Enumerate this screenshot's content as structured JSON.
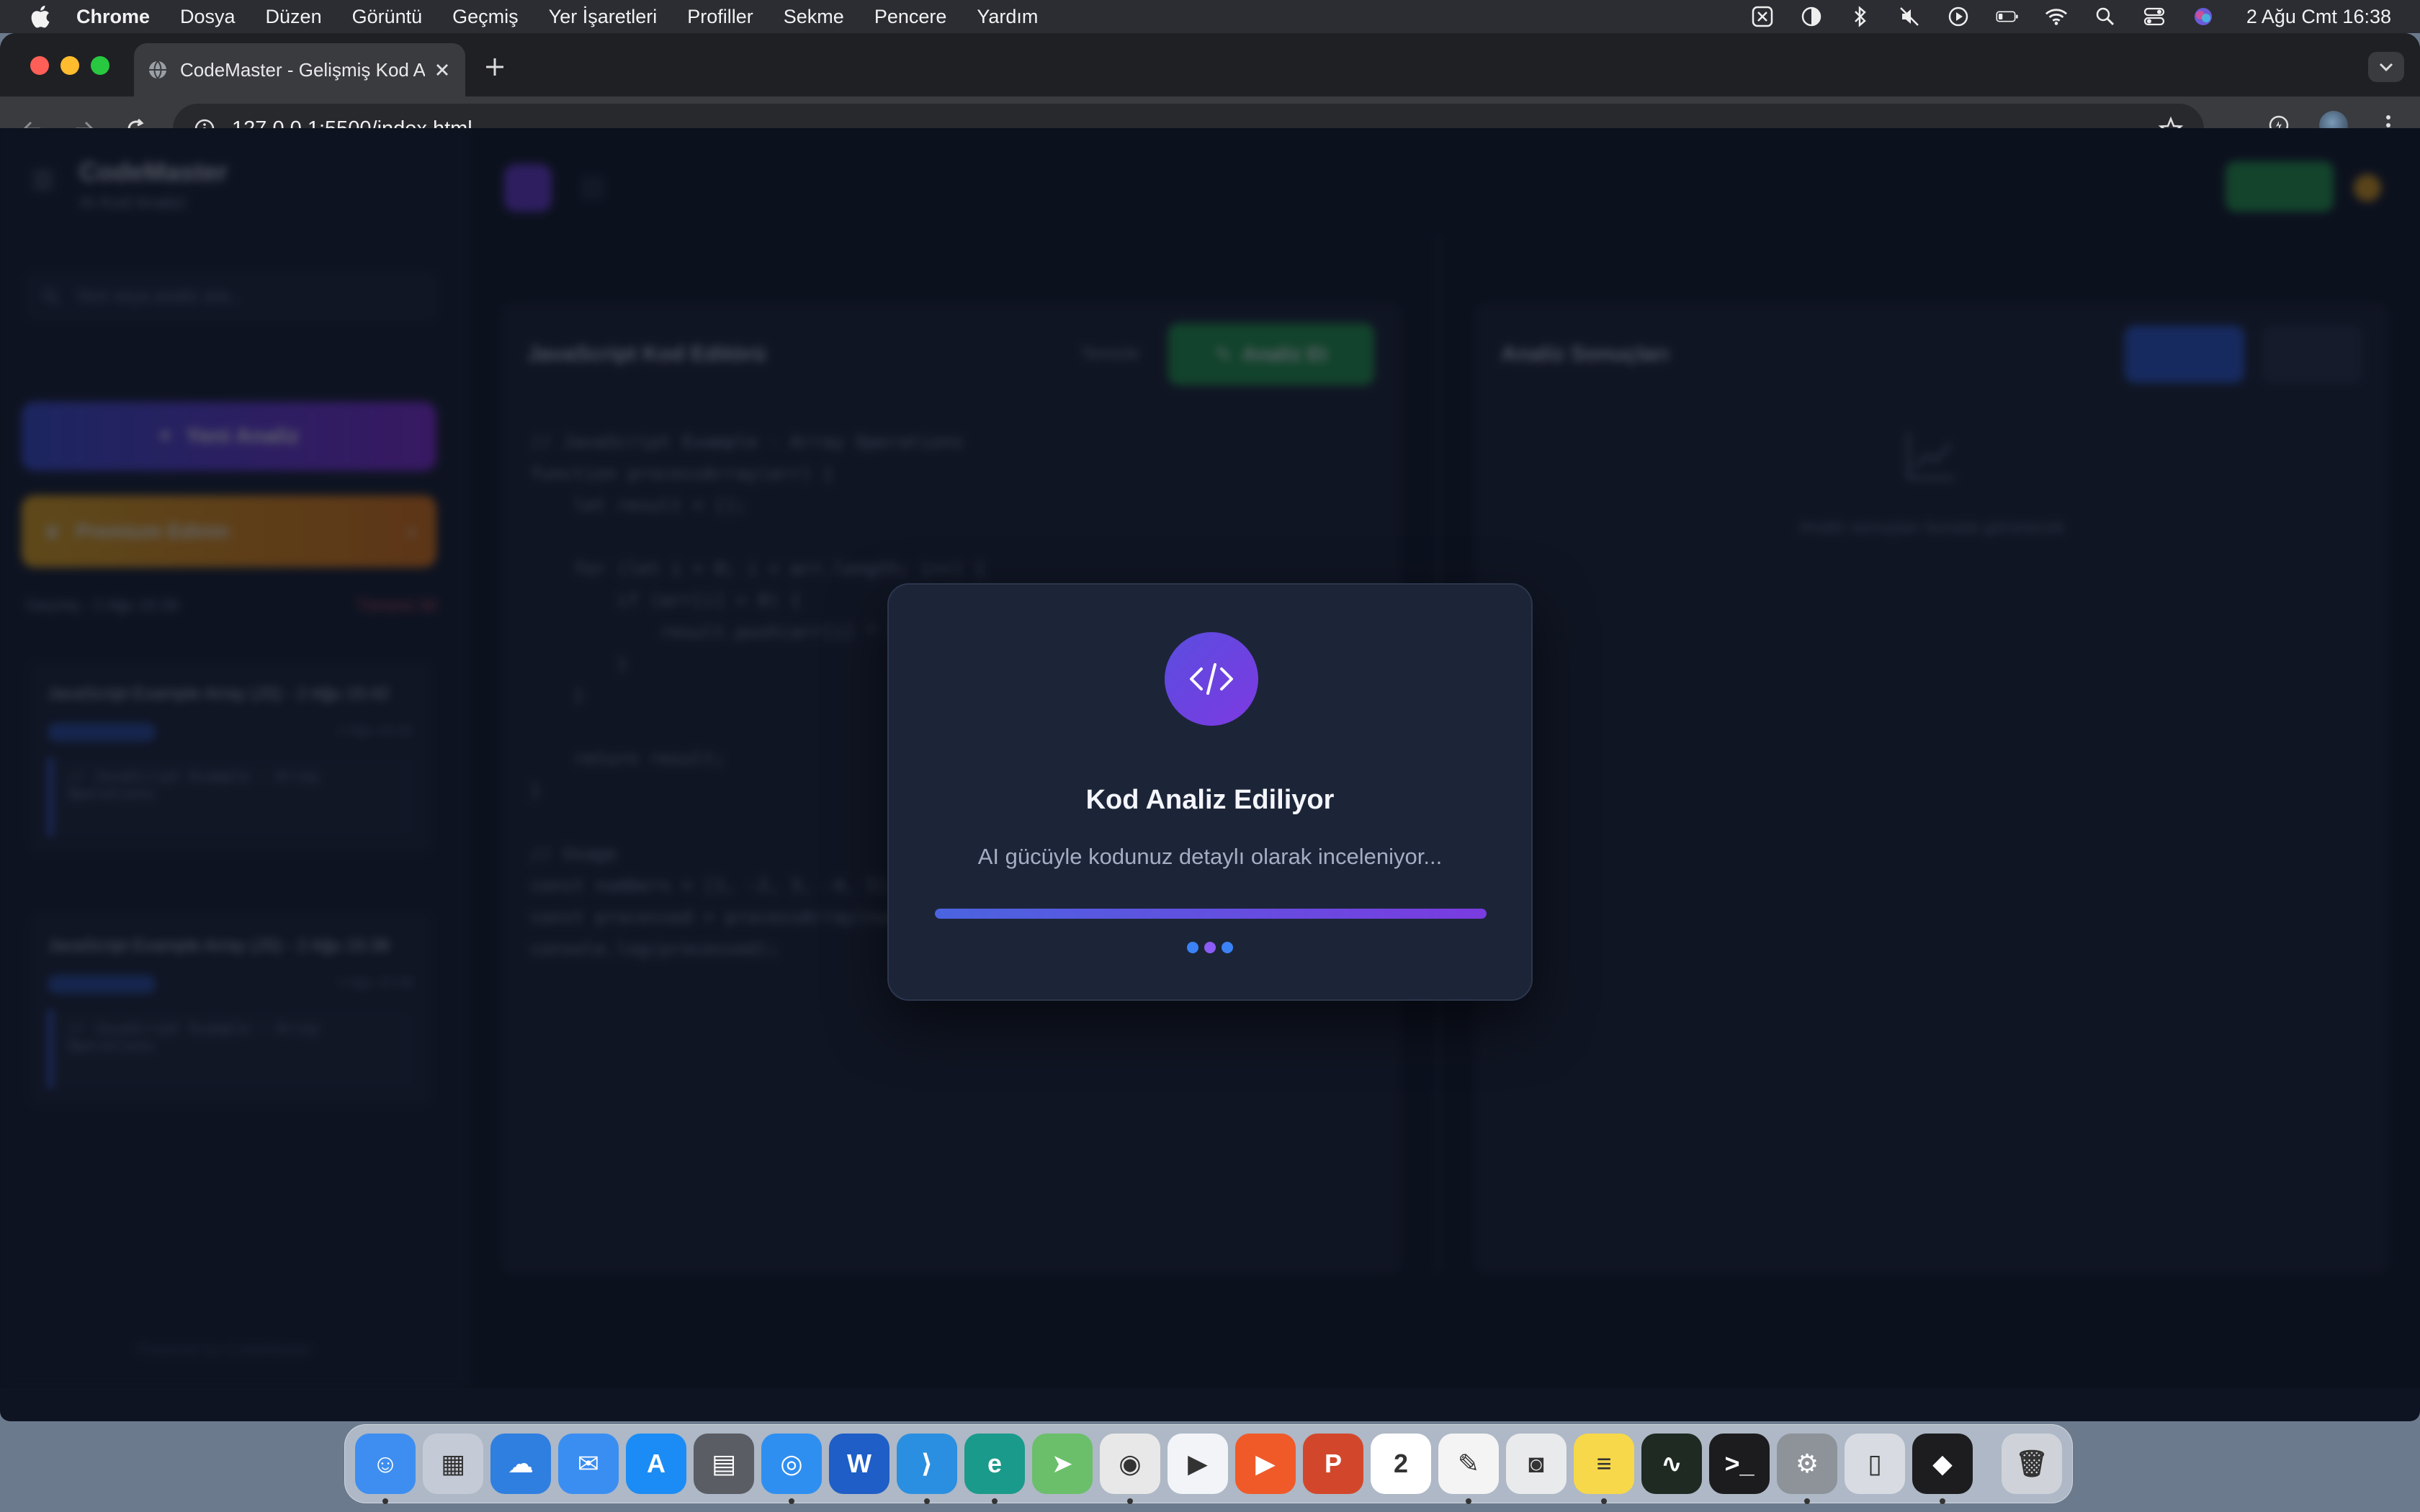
{
  "menubar": {
    "app_name": "Chrome",
    "menus": [
      "Dosya",
      "Düzen",
      "Görüntü",
      "Geçmiş",
      "Yer İşaretleri",
      "Profiller",
      "Sekme",
      "Pencere",
      "Yardım"
    ],
    "clock": "2 Ağu Cmt  16:38"
  },
  "browser": {
    "tab_title": "CodeMaster - Gelişmiş Kod A",
    "url": "127.0.0.1:5500/index.html"
  },
  "app": {
    "brand": "CodeMaster",
    "brand_sub": "AI Kod Analizi",
    "search_placeholder": "Yeni veya analiz ara...",
    "new_analysis": "Yeni Analiz",
    "premium": "Premium Edinin",
    "history_label": "Geçmiş - 2 Ağu 15:39",
    "clear_all": "Tümünü Sil",
    "history": [
      {
        "title": "JavaScript Example Array (JS) - 2 Ağu 15:42",
        "time": "2 Ağu 15:42",
        "preview": "// JavaScript Example - Array Operations"
      },
      {
        "title": "JavaScript Example Array (JS) - 2 Ağu 15:38",
        "time": "2 Ağu 15:38",
        "preview": "// JavaScript Example - Array Operations"
      }
    ],
    "footer": "Powered by CodeMaster",
    "editor_title": "JavaScript Kod Editörü",
    "clear_button": "Temizle",
    "analyze_button": "Analiz Et",
    "results_title": "Analiz Sonuçları",
    "empty_results": "Analiz sonuçları burada görünecek",
    "code": "// JavaScript Example - Array Operations\nfunction processArray(arr) {\n    let result = [];\n\n    for (let i = 0; i < arr.length; i++) {\n        if (arr[i] > 0) {\n            result.push(arr[i] * 2);\n        }\n    }\n\n    return result;\n}\n\n// Usage\nconst numbers = [1, -2, 3, -4, 5];\nconst processed = processArray(numbers);\nconsole.log(processed);"
  },
  "modal": {
    "title": "Kod Analiz Ediliyor",
    "subtitle": "AI gücüyle kodunuz detaylı olarak inceleniyor...",
    "progress": 1.0,
    "dot_colors": [
      "#3b82f6",
      "#8b5cf6",
      "#3b82f6"
    ]
  },
  "dock": {
    "apps": [
      {
        "name": "finder-icon",
        "bg": "#3d8ef0",
        "glyph": "☺",
        "running": true
      },
      {
        "name": "launchpad-icon",
        "bg": "#c4cbd6",
        "glyph": "▦",
        "running": false
      },
      {
        "name": "weather-icon",
        "bg": "#2f7fe0",
        "glyph": "☁",
        "running": false
      },
      {
        "name": "mail-icon",
        "bg": "#3a8ef2",
        "glyph": "✉",
        "running": false
      },
      {
        "name": "app-store-icon",
        "bg": "#1b8cf5",
        "glyph": "A",
        "running": false
      },
      {
        "name": "calculator-icon",
        "bg": "#5a5d63",
        "glyph": "▤",
        "running": false
      },
      {
        "name": "safari-icon",
        "bg": "#2f8ff0",
        "glyph": "◎",
        "running": true
      },
      {
        "name": "word-icon",
        "bg": "#1f5ec6",
        "glyph": "W",
        "running": false
      },
      {
        "name": "vscode-icon",
        "bg": "#2a8fe0",
        "glyph": "⟩",
        "running": true
      },
      {
        "name": "edge-icon",
        "bg": "#1a9a8a",
        "glyph": "e",
        "running": true
      },
      {
        "name": "maps-icon",
        "bg": "#6bbf6a",
        "glyph": "➤",
        "running": false
      },
      {
        "name": "chrome-icon",
        "bg": "#e8e8e8",
        "glyph": "◉",
        "running": true
      },
      {
        "name": "play-icon",
        "bg": "#f2f4f7",
        "glyph": "▶",
        "running": false
      },
      {
        "name": "infuse-icon",
        "bg": "#f05a28",
        "glyph": "▶",
        "running": false
      },
      {
        "name": "powerpoint-icon",
        "bg": "#d2472b",
        "glyph": "P",
        "running": false
      },
      {
        "name": "calendar-icon",
        "bg": "#ffffff",
        "glyph": "2",
        "running": false
      },
      {
        "name": "textedit-icon",
        "bg": "#f4f4f4",
        "glyph": "✎",
        "running": true
      },
      {
        "name": "screenshot-icon",
        "bg": "#e9eaec",
        "glyph": "◙",
        "running": false
      },
      {
        "name": "notes-icon",
        "bg": "#f7d84a",
        "glyph": "≡",
        "running": true
      },
      {
        "name": "activity-monitor-icon",
        "bg": "#1e2a22",
        "glyph": "∿",
        "running": false
      },
      {
        "name": "terminal-icon",
        "bg": "#1c1c1e",
        "glyph": ">_",
        "running": false
      },
      {
        "name": "system-settings-icon",
        "bg": "#8e9299",
        "glyph": "⚙",
        "running": true
      },
      {
        "name": "iphone-mirroring-icon",
        "bg": "#d8dce2",
        "glyph": "▯",
        "running": false
      },
      {
        "name": "parallels-icon",
        "bg": "#1d1d1f",
        "glyph": "◆",
        "running": true
      }
    ],
    "trash": {
      "name": "trash-icon",
      "bg": "#cfd3d9",
      "glyph": "🗑"
    }
  },
  "colors": {
    "accent_purple": "#7d3ae0",
    "accent_blue": "#4a64e0",
    "page_bg": "#0f1523"
  }
}
